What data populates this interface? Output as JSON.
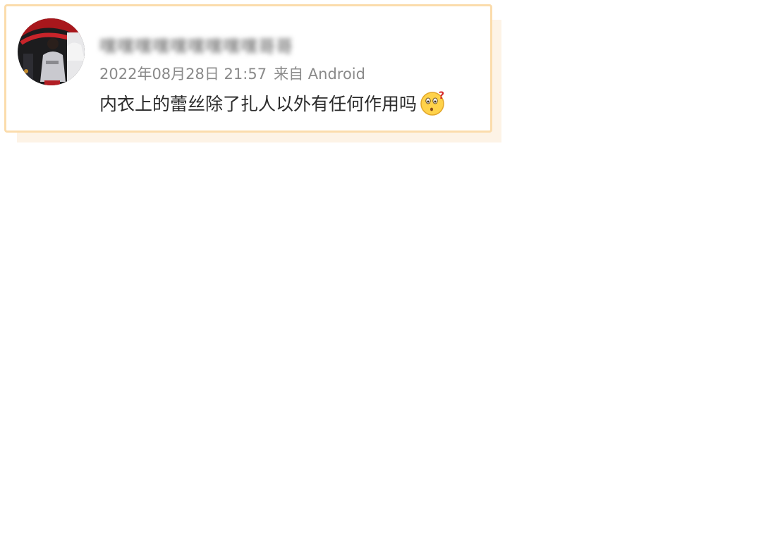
{
  "post": {
    "username": "嘿嘿嘿嘿嘿嘿嘿嘿嘿哥哥",
    "timestamp": "2022年08月28日 21:57",
    "source": "来自 Android",
    "text": "内衣上的蕾丝除了扎人以外有任何作用吗",
    "emoji": "confused-question-emoji"
  },
  "colors": {
    "card_border": "#fbdcac",
    "card_shadow": "#fdf3e6",
    "meta_text": "#8a8a8a",
    "body_text": "#2b2b2b"
  }
}
